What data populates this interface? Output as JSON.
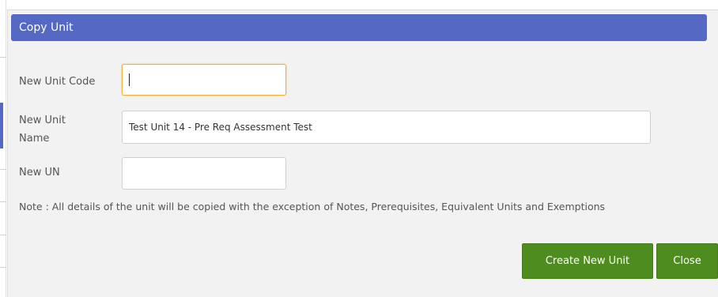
{
  "dialog": {
    "title": "Copy Unit",
    "fields": {
      "unit_code": {
        "label": "New Unit Code",
        "value": ""
      },
      "unit_name": {
        "label_line1": "New Unit",
        "label_line2": "Name",
        "value": "Test Unit 14 - Pre Req Assessment Test"
      },
      "un": {
        "label": "New UN",
        "value": ""
      }
    },
    "note": "Note : All details of the unit will be copied with the exception of Notes, Prerequisites, Equivalent Units and Exemptions",
    "buttons": {
      "create": "Create New Unit",
      "close": "Close"
    }
  },
  "colors": {
    "title_bar": "#5468c4",
    "button": "#4f8c1f",
    "focus_border": "#f0b040"
  }
}
